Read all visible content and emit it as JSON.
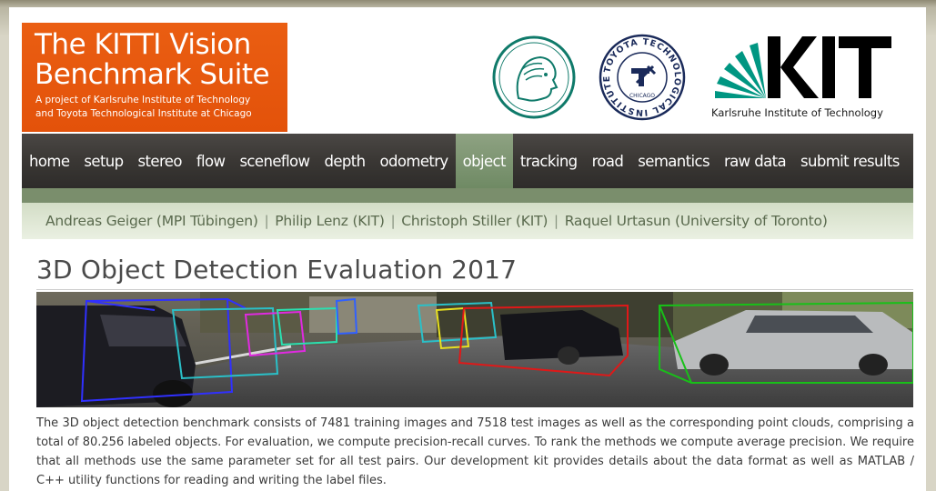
{
  "header": {
    "title": "The KITTI Vision Benchmark Suite",
    "subtitle_line1": "A project of Karlsruhe Institute of Technology",
    "subtitle_line2": "and Toyota Technological Institute at Chicago",
    "kit_logo_text": "Karlsruhe Institute of Technology",
    "ttic_logo_text": "TOYOTA TECHNOLOGICAL INSTITUTE",
    "ttic_logo_city": "CHICAGO"
  },
  "nav": {
    "items": [
      {
        "label": "home"
      },
      {
        "label": "setup"
      },
      {
        "label": "stereo"
      },
      {
        "label": "flow"
      },
      {
        "label": "sceneflow"
      },
      {
        "label": "depth"
      },
      {
        "label": "odometry"
      },
      {
        "label": "object",
        "active": true
      },
      {
        "label": "tracking"
      },
      {
        "label": "road"
      },
      {
        "label": "semantics"
      },
      {
        "label": "raw data"
      },
      {
        "label": "submit results"
      }
    ]
  },
  "authors": [
    "Andreas Geiger (MPI Tübingen)",
    "Philip Lenz (KIT)",
    "Christoph Stiller (KIT)",
    "Raquel Urtasun (University of Toronto)"
  ],
  "authors_separator": "|",
  "main": {
    "title": "3D Object Detection Evaluation 2017",
    "description": "The 3D object detection benchmark consists of 7481 training images and 7518 test images as well as the corresponding point clouds, comprising a total of 80.256 labeled objects. For evaluation, we compute precision-recall curves. To rank the methods we compute average precision. We require that all methods use the same parameter set for all test pairs. Our development kit provides details about the data format as well as MATLAB / C++ utility functions for reading and writing the label files."
  },
  "colors": {
    "brand_orange": "#e6530c",
    "nav_dark": "#3a3734",
    "nav_active": "#7f9574",
    "author_text": "#5a6a4e",
    "kit_green": "#009682"
  }
}
